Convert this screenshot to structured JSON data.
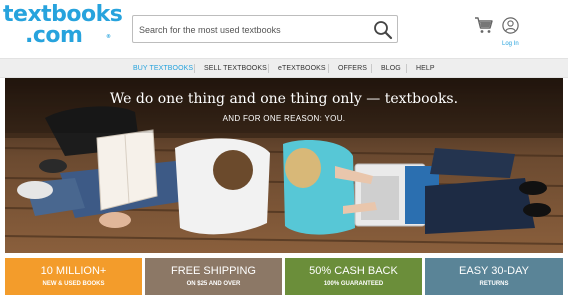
{
  "brand": {
    "logo_top": "textbooks",
    "logo_bottom": ".com",
    "trademark": "®",
    "color": "#27a3dd"
  },
  "search": {
    "placeholder": "Search for the most used textbooks",
    "icon": "search-icon"
  },
  "account": {
    "cart_icon": "cart-icon",
    "user_icon": "user-icon",
    "login_label": "Log In"
  },
  "nav": {
    "items": [
      {
        "label": "BUY TEXTBOOKS",
        "active": true
      },
      {
        "label": "SELL TEXTBOOKS",
        "active": false
      },
      {
        "label": "eTEXTBOOKS",
        "active": false
      },
      {
        "label": "OFFERS",
        "active": false
      },
      {
        "label": "BLOG",
        "active": false
      },
      {
        "label": "HELP",
        "active": false
      }
    ]
  },
  "hero": {
    "title": "We do one thing and one thing only — textbooks.",
    "subtitle": "AND FOR ONE REASON: YOU."
  },
  "promos": [
    {
      "big": "10 MILLION+",
      "small": "NEW & USED BOOKS",
      "color": "#f39c2b"
    },
    {
      "big": "FREE SHIPPING",
      "small": "ON $25 AND OVER",
      "color": "#8c7866"
    },
    {
      "big": "50% CASH BACK",
      "small": "100% GUARANTEED",
      "color": "#6b8e3a"
    },
    {
      "big": "EASY 30-DAY",
      "small": "RETURNS",
      "color": "#5a8497"
    }
  ]
}
